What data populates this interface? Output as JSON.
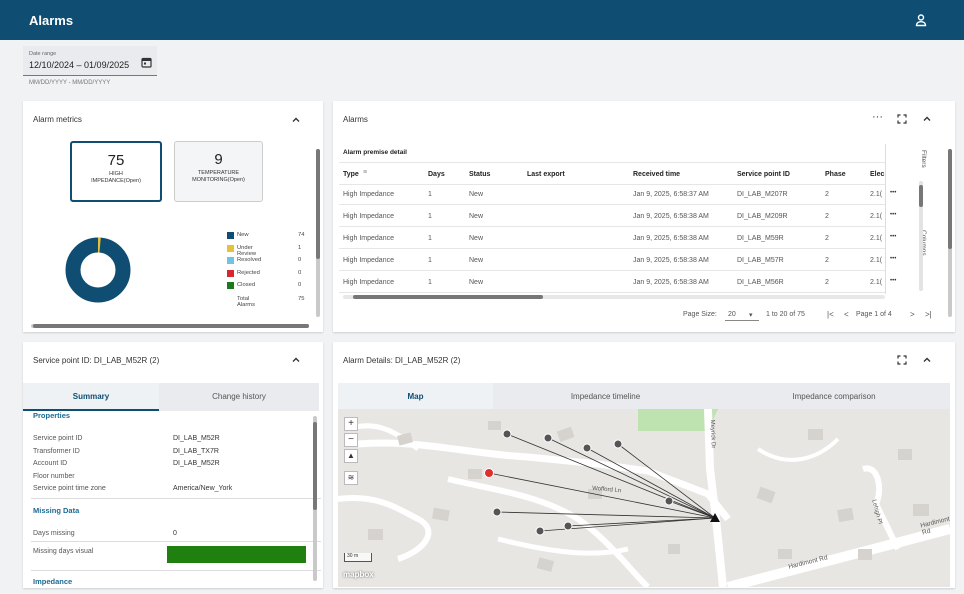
{
  "app": {
    "title": "Alarms"
  },
  "date_range": {
    "label": "Date range",
    "value": "12/10/2024 – 01/09/2025",
    "hint": "MM/DD/YYYY - MM/DD/YYYY"
  },
  "metrics_card": {
    "title": "Alarm metrics",
    "boxes": [
      {
        "count": "75",
        "label_line1": "HIGH",
        "label_line2": "IMPEDANCE(Open)"
      },
      {
        "count": "9",
        "label_line1": "TEMPERATURE",
        "label_line2": "MONITORING(Open)"
      }
    ],
    "legend": [
      {
        "name": "New",
        "value": "74",
        "color": "#0f4d72"
      },
      {
        "name": "Under Review",
        "value": "1",
        "color": "#e8c13a"
      },
      {
        "name": "Resolved",
        "value": "0",
        "color": "#6ec3e6"
      },
      {
        "name": "Rejected",
        "value": "0",
        "color": "#d9262b"
      },
      {
        "name": "Closed",
        "value": "0",
        "color": "#1c7a1c"
      },
      {
        "name": "Total Alarms",
        "value": "75",
        "color": ""
      }
    ]
  },
  "alarms_card": {
    "title": "Alarms",
    "subtitle": "Alarm premise detail",
    "columns": [
      "Type",
      "Days",
      "Status",
      "Last export",
      "Received time",
      "Service point ID",
      "Phase",
      "Elec"
    ],
    "rows": [
      {
        "type": "High Impedance",
        "days": "1",
        "status": "New",
        "last_export": "",
        "received": "Jan 9, 2025, 6:58:37 AM",
        "spid": "DI_LAB_M207R",
        "phase": "2",
        "elec": "2.1("
      },
      {
        "type": "High Impedance",
        "days": "1",
        "status": "New",
        "last_export": "",
        "received": "Jan 9, 2025, 6:58:38 AM",
        "spid": "DI_LAB_M209R",
        "phase": "2",
        "elec": "2.1("
      },
      {
        "type": "High Impedance",
        "days": "1",
        "status": "New",
        "last_export": "",
        "received": "Jan 9, 2025, 6:58:38 AM",
        "spid": "DI_LAB_M59R",
        "phase": "2",
        "elec": "2.1("
      },
      {
        "type": "High Impedance",
        "days": "1",
        "status": "New",
        "last_export": "",
        "received": "Jan 9, 2025, 6:58:38 AM",
        "spid": "DI_LAB_M57R",
        "phase": "2",
        "elec": "2.1("
      },
      {
        "type": "High Impedance",
        "days": "1",
        "status": "New",
        "last_export": "",
        "received": "Jan 9, 2025, 6:58:38 AM",
        "spid": "DI_LAB_M56R",
        "phase": "2",
        "elec": "2.1("
      }
    ],
    "side_tabs": [
      "Filters",
      "Columns"
    ],
    "pager": {
      "page_size_label": "Page Size:",
      "page_size": "20",
      "range": "1 to 20 of 75",
      "page": "Page 1 of 4"
    }
  },
  "sp_card": {
    "title": "Service point ID: DI_LAB_M52R (2)",
    "tabs": [
      "Summary",
      "Change history"
    ],
    "properties_title": "Properties",
    "properties": [
      {
        "label": "Service point ID",
        "value": "DI_LAB_M52R"
      },
      {
        "label": "Transformer ID",
        "value": "DI_LAB_TX7R"
      },
      {
        "label": "Account ID",
        "value": "DI_LAB_M52R"
      },
      {
        "label": "Floor number",
        "value": ""
      },
      {
        "label": "Service point time zone",
        "value": "America/New_York"
      }
    ],
    "missing_title": "Missing Data",
    "days_missing_label": "Days missing",
    "days_missing": "0",
    "missing_visual_label": "Missing days visual",
    "impedance_title": "Impedance"
  },
  "details_card": {
    "title": "Alarm Details: DI_LAB_M52R (2)",
    "tabs": [
      "Map",
      "Impedance timeline",
      "Impedance comparison"
    ],
    "map": {
      "street1": "Wofford Ln",
      "street2": "Hardimont Rd",
      "street3": "Lehigh Pl",
      "street4": "Hardimont Rd",
      "street5": "Meyrick Dr",
      "scale": "30 m",
      "attribution": "mapbox"
    }
  }
}
